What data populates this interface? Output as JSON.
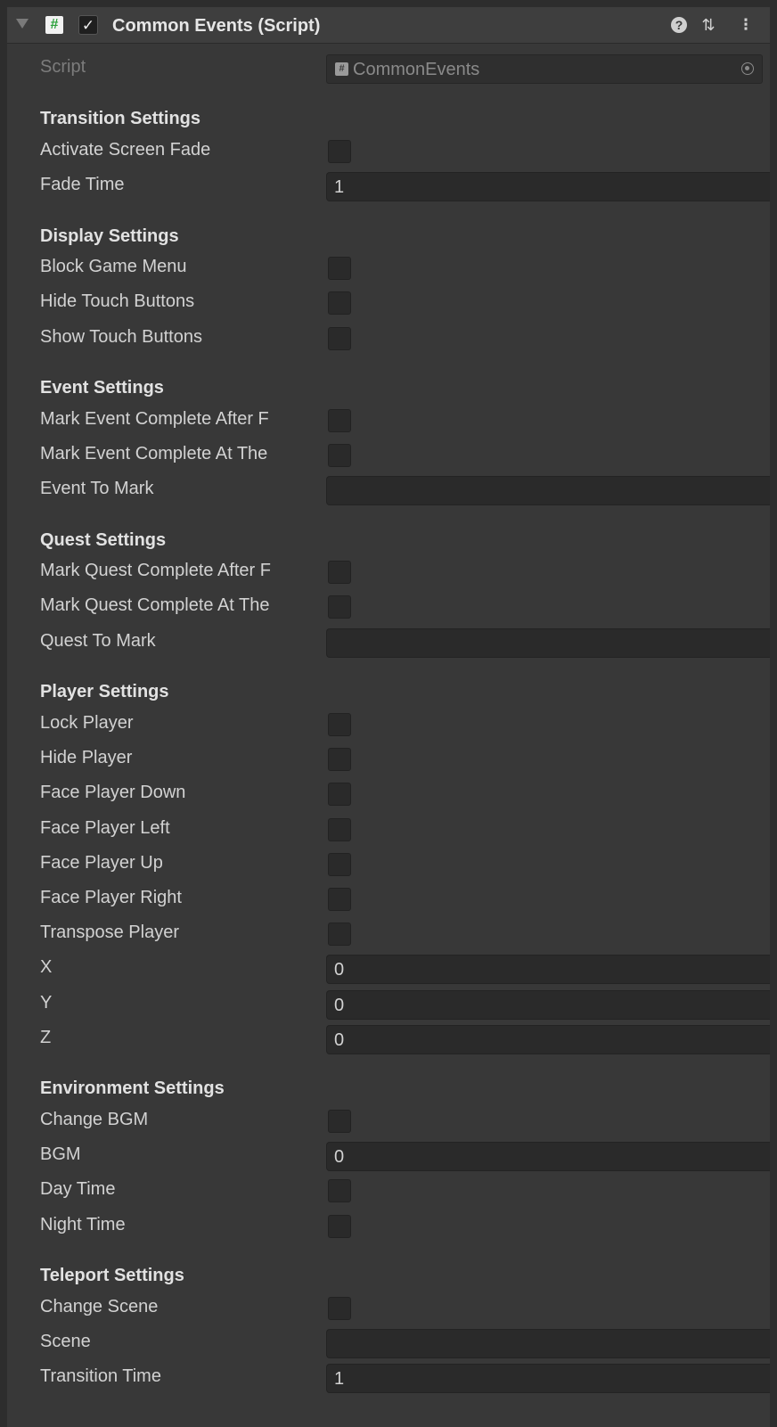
{
  "header": {
    "title": "Common Events (Script)",
    "enabled": true,
    "help_icon": "help-icon",
    "preset_icon": "preset-icon",
    "menu_icon": "kebab-menu-icon"
  },
  "script_field": {
    "label": "Script",
    "value": "CommonEvents"
  },
  "transition": {
    "title": "Transition Settings",
    "activate_screen_fade": "Activate Screen Fade",
    "fade_time": "Fade Time",
    "fade_time_value": "1"
  },
  "display": {
    "title": "Display Settings",
    "block_game_menu": "Block Game Menu",
    "hide_touch_buttons": "Hide Touch Buttons",
    "show_touch_buttons": "Show Touch Buttons"
  },
  "event": {
    "title": "Event Settings",
    "mark_after": "Mark Event Complete After F",
    "mark_at_the": "Mark Event Complete At The",
    "event_to_mark": "Event To Mark",
    "event_to_mark_value": ""
  },
  "quest": {
    "title": "Quest Settings",
    "mark_after": "Mark Quest Complete After F",
    "mark_at_the": "Mark Quest Complete At The",
    "quest_to_mark": "Quest To Mark",
    "quest_to_mark_value": ""
  },
  "player": {
    "title": "Player Settings",
    "lock_player": "Lock Player",
    "hide_player": "Hide Player",
    "face_down": "Face Player Down",
    "face_left": "Face Player Left",
    "face_up": "Face Player Up",
    "face_right": "Face Player Right",
    "transpose_player": "Transpose Player",
    "x_label": "X",
    "x_value": "0",
    "y_label": "Y",
    "y_value": "0",
    "z_label": "Z",
    "z_value": "0"
  },
  "environment": {
    "title": "Environment Settings",
    "change_bgm": "Change BGM",
    "bgm": "BGM",
    "bgm_value": "0",
    "day_time": "Day Time",
    "night_time": "Night Time"
  },
  "teleport": {
    "title": "Teleport Settings",
    "change_scene": "Change Scene",
    "scene": "Scene",
    "scene_value": "",
    "transition_time": "Transition Time",
    "transition_time_value": "1"
  }
}
